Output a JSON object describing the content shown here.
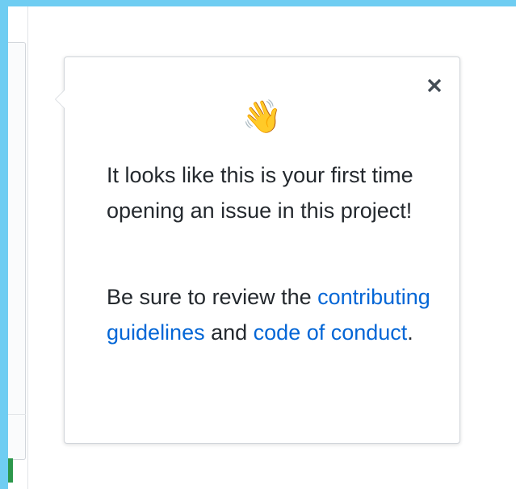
{
  "colors": {
    "background_accent": "#6fcdf2",
    "link": "#0366d6",
    "text": "#24292e",
    "popover_border": "#d1d5da"
  },
  "popover": {
    "icon": "waving-hand-icon",
    "emoji": "👋",
    "close_icon": "close-icon",
    "first_visit_message": "It looks like this is your first time opening an issue in this project!",
    "review_prefix": "Be sure to review the ",
    "contributing_link": "contributing guidelines",
    "and_text": " and ",
    "conduct_link": "code of conduct",
    "period": "."
  }
}
